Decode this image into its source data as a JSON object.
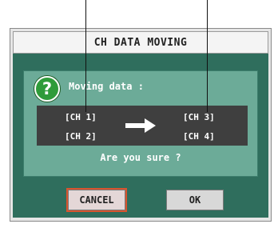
{
  "dialog": {
    "title": "CH DATA MOVING",
    "message": "Moving data :",
    "question": "Are you sure ?",
    "icon": "question-icon"
  },
  "channels": {
    "source": [
      "[CH 1]",
      "[CH 2]"
    ],
    "destination": [
      "[CH 3]",
      "[CH 4]"
    ]
  },
  "buttons": {
    "cancel_label": "CANCEL",
    "ok_label": "OK"
  },
  "colors": {
    "dialog_background": "#2f6e5d",
    "message_panel": "#6cab98",
    "channel_box": "#3f3f3f",
    "icon_green": "#2f9b3a",
    "cancel_focus_border": "#d9542e"
  }
}
